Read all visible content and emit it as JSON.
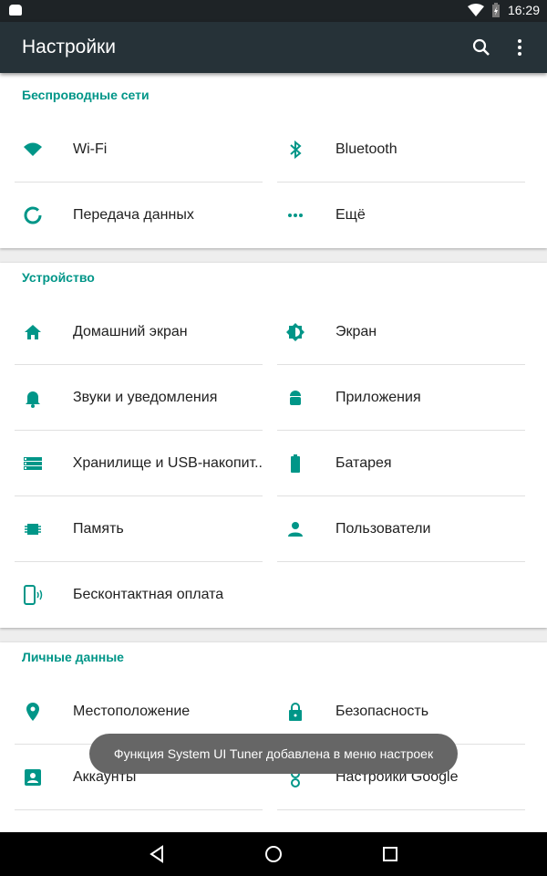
{
  "status_bar": {
    "time": "16:29",
    "icons": [
      "android-icon",
      "wifi-icon",
      "battery-charging-icon"
    ]
  },
  "toolbar": {
    "title": "Настройки",
    "icons": [
      "search-icon",
      "more-vert-icon"
    ]
  },
  "sections": [
    {
      "title": "Беспроводные сети",
      "items": [
        {
          "label": "Wi-Fi",
          "icon": "wifi-icon"
        },
        {
          "label": "Bluetooth",
          "icon": "bluetooth-icon"
        },
        {
          "label": "Передача данных",
          "icon": "data-usage-icon"
        },
        {
          "label": "Ещё",
          "icon": "more-horiz-icon"
        }
      ]
    },
    {
      "title": "Устройство",
      "items": [
        {
          "label": "Домашний экран",
          "icon": "home-icon"
        },
        {
          "label": "Экран",
          "icon": "brightness-icon"
        },
        {
          "label": "Звуки и уведомления",
          "icon": "bell-icon"
        },
        {
          "label": "Приложения",
          "icon": "android-icon"
        },
        {
          "label": "Хранилище и USB-накопит..",
          "icon": "storage-icon"
        },
        {
          "label": "Батарея",
          "icon": "battery-icon"
        },
        {
          "label": "Память",
          "icon": "memory-icon"
        },
        {
          "label": "Пользователи",
          "icon": "person-icon"
        },
        {
          "label": "Бесконтактная оплата",
          "icon": "nfc-phone-icon"
        }
      ]
    },
    {
      "title": "Личные данные",
      "items": [
        {
          "label": "Местоположение",
          "icon": "location-icon"
        },
        {
          "label": "Безопасность",
          "icon": "lock-icon"
        },
        {
          "label": "Аккаунты",
          "icon": "account-box-icon"
        },
        {
          "label": "Настройки Google",
          "icon": "google-icon"
        }
      ]
    }
  ],
  "toast": "Функция System UI Tuner добавлена в меню настроек",
  "nav_bar": {
    "icons": [
      "back-icon",
      "home-circle-icon",
      "recents-icon"
    ]
  },
  "colors": {
    "accent": "#009688",
    "toolbar": "#263238"
  }
}
